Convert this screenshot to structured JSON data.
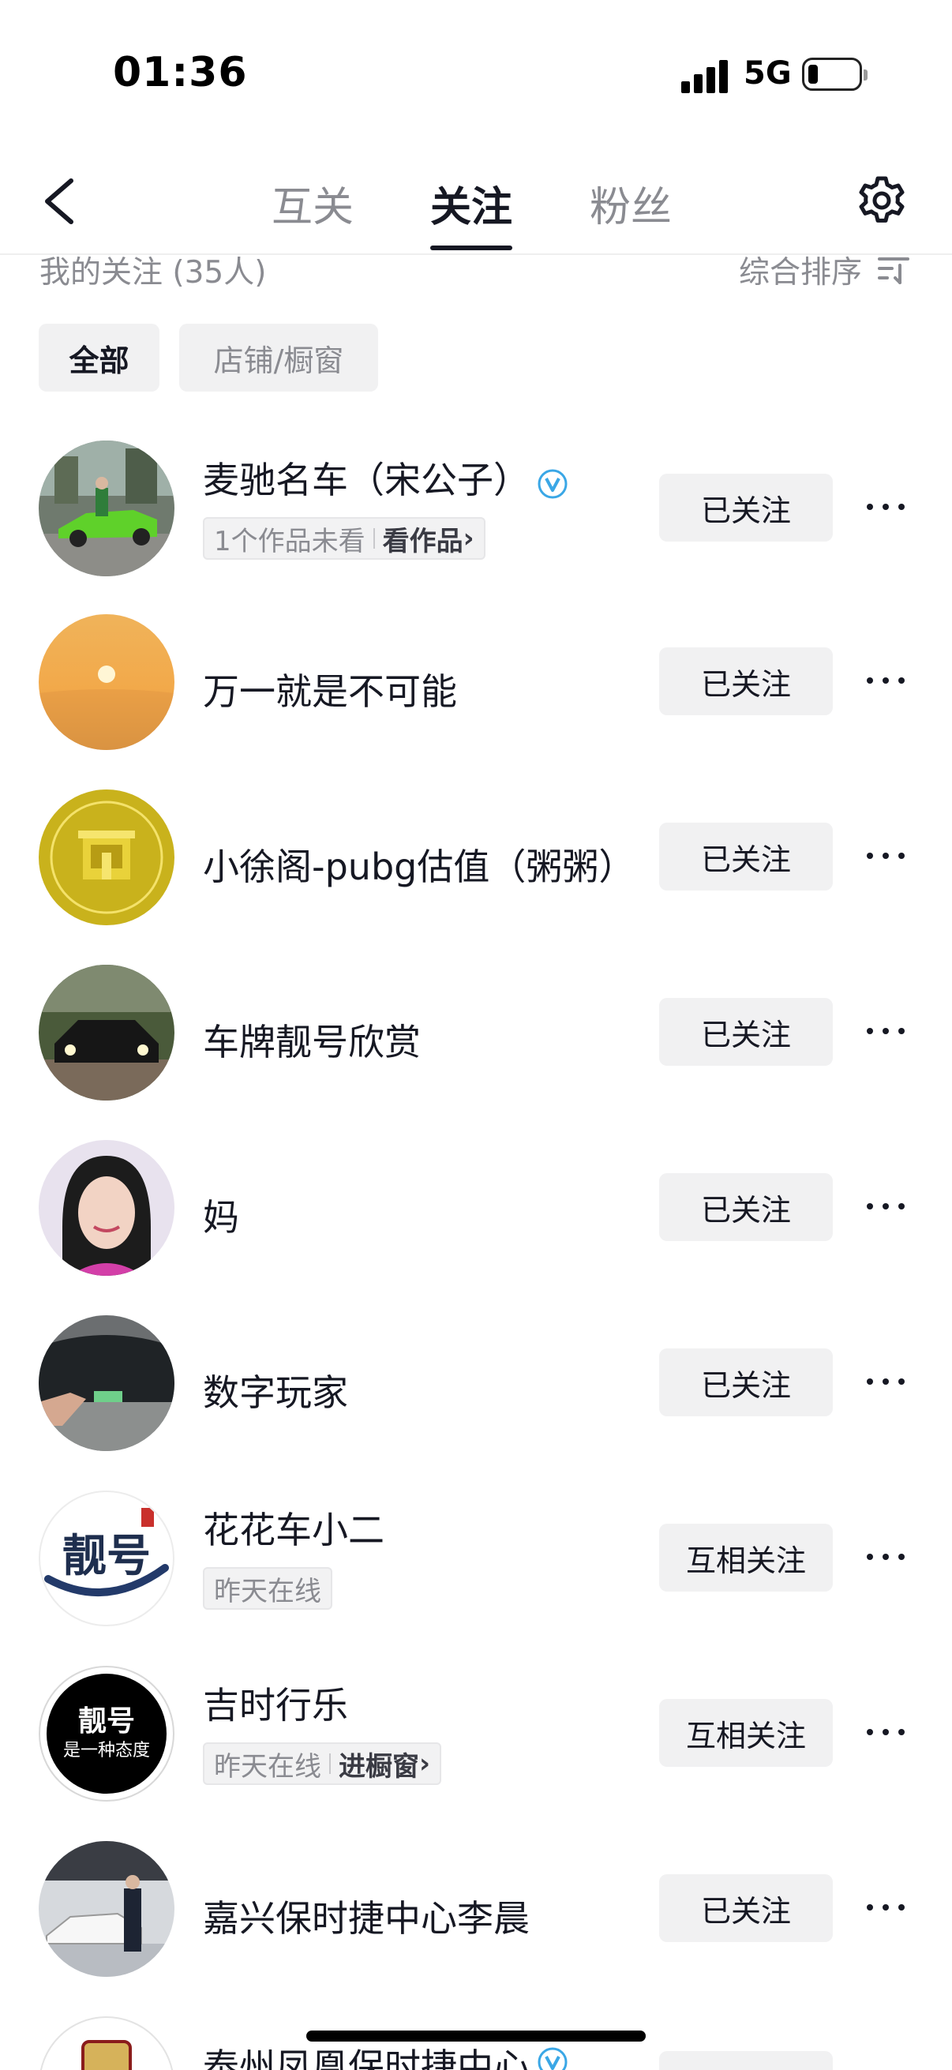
{
  "status_bar": {
    "time": "01:36",
    "network": "5G"
  },
  "nav": {
    "tabs": [
      {
        "label": "互关",
        "active": false
      },
      {
        "label": "关注",
        "active": true
      },
      {
        "label": "粉丝",
        "active": false
      }
    ]
  },
  "subheader": {
    "title": "我的关注 (35人)",
    "sort_label": "综合排序"
  },
  "filters": {
    "all": "全部",
    "shop": "店铺/橱窗"
  },
  "list": [
    {
      "name": "麦驰名车（宋公子）",
      "verified": true,
      "sub": "1个作品未看",
      "sub_link": "看作品",
      "button": "已关注",
      "avatar_icon": "green-sports-car-avatar"
    },
    {
      "name": "万一就是不可能",
      "verified": false,
      "sub": "",
      "sub_link": "",
      "button": "已关注",
      "avatar_icon": "sunset-avatar"
    },
    {
      "name": "小徐阁-pubg估值（粥粥）",
      "verified": false,
      "sub": "",
      "sub_link": "",
      "button": "已关注",
      "avatar_icon": "game-trading-logo-avatar"
    },
    {
      "name": "车牌靓号欣赏",
      "verified": false,
      "sub": "",
      "sub_link": "",
      "button": "已关注",
      "avatar_icon": "black-car-avatar"
    },
    {
      "name": "妈",
      "verified": false,
      "sub": "",
      "sub_link": "",
      "button": "已关注",
      "avatar_icon": "woman-portrait-avatar"
    },
    {
      "name": "数字玩家",
      "verified": false,
      "sub": "",
      "sub_link": "",
      "button": "已关注",
      "avatar_icon": "tesla-car-avatar"
    },
    {
      "name": "花花车小二",
      "verified": false,
      "sub": "昨天在线",
      "sub_link": "",
      "button": "互相关注",
      "avatar_icon": "calligraphy-logo-avatar"
    },
    {
      "name": "吉时行乐",
      "verified": false,
      "sub": "昨天在线",
      "sub_link": "进橱窗",
      "button": "互相关注",
      "avatar_icon": "black-circle-logo-avatar"
    },
    {
      "name": "嘉兴保时捷中心李晨",
      "verified": false,
      "sub": "",
      "sub_link": "",
      "button": "已关注",
      "avatar_icon": "porsche-showroom-avatar"
    },
    {
      "name": "泰州凤凰保时捷中心",
      "verified": true,
      "sub": "",
      "sub_link": "",
      "button": "",
      "avatar_icon": "porsche-logo-avatar"
    }
  ],
  "logo_text": {
    "calligraphy": "靓号",
    "black_logo_line1": "靓号",
    "black_logo_line2": "是一种态度"
  },
  "colors": {
    "verified": "#3aa7e6",
    "active_text": "#161823",
    "inactive_text": "#8a8b91",
    "button_bg": "#f1f1f2"
  }
}
